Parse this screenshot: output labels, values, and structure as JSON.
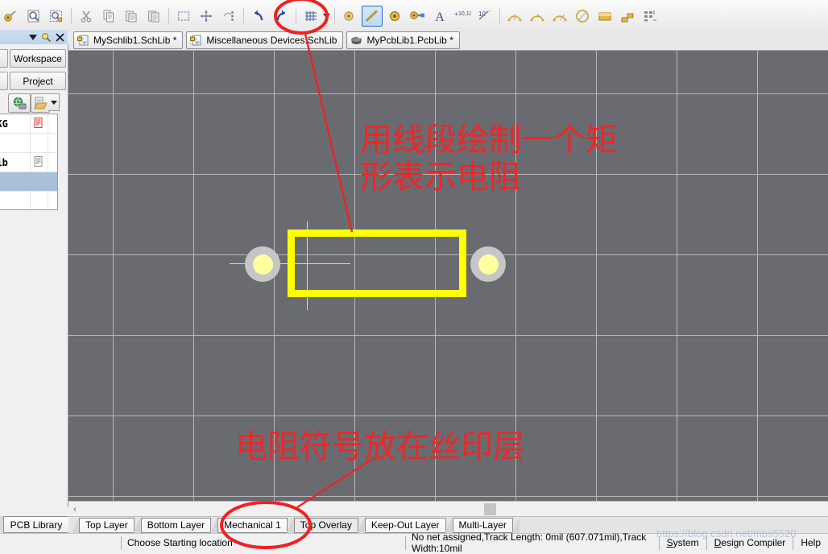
{
  "toolbar": {
    "groups": [
      {
        "name": "file-ops",
        "buttons": [
          {
            "name": "open-icon",
            "glyph": "⚷"
          },
          {
            "name": "zoom-document-icon",
            "glyph": "⌕"
          },
          {
            "name": "zoom-area-icon",
            "glyph": "⌕"
          }
        ]
      },
      {
        "name": "clipboard",
        "buttons": [
          {
            "name": "cut-icon",
            "glyph": "✂"
          },
          {
            "name": "copy-icon",
            "glyph": "⧉"
          },
          {
            "name": "paste-icon",
            "glyph": "⧉"
          },
          {
            "name": "paste-special-icon",
            "glyph": "⧉"
          }
        ]
      },
      {
        "name": "select",
        "buttons": [
          {
            "name": "select-area-icon",
            "glyph": "□"
          },
          {
            "name": "move-icon",
            "glyph": "✛"
          },
          {
            "name": "align-icon",
            "glyph": "⋮"
          }
        ]
      },
      {
        "name": "undo-redo",
        "buttons": [
          {
            "name": "undo-icon",
            "glyph": "↶"
          },
          {
            "name": "redo-icon",
            "glyph": "↷"
          }
        ]
      },
      {
        "name": "grid",
        "buttons": [
          {
            "name": "grid-icon",
            "glyph": "▦"
          },
          {
            "name": "grid-dropdown-arrow-icon",
            "glyph": "▾"
          }
        ]
      },
      {
        "name": "place",
        "buttons": [
          {
            "name": "place-pad-left-icon",
            "glyph": "◎"
          },
          {
            "name": "place-line-icon",
            "glyph": "╱",
            "selected": true
          },
          {
            "name": "place-pad-icon",
            "glyph": "◎"
          },
          {
            "name": "place-via-icon",
            "glyph": "⚷"
          },
          {
            "name": "place-string-icon",
            "glyph": "A"
          },
          {
            "name": "place-coordinate-icon",
            "glyph": "10,10"
          },
          {
            "name": "place-dimension-icon",
            "glyph": "↗"
          }
        ]
      },
      {
        "name": "arcs",
        "buttons": [
          {
            "name": "arc-center-icon",
            "glyph": "◜"
          },
          {
            "name": "arc-edge-icon",
            "glyph": "◜"
          },
          {
            "name": "arc-any-angle-icon",
            "glyph": "◜"
          },
          {
            "name": "full-circle-icon",
            "glyph": "○"
          },
          {
            "name": "place-fill-icon",
            "glyph": "▬"
          },
          {
            "name": "place-polygon-icon",
            "glyph": "▰"
          },
          {
            "name": "place-array-icon",
            "glyph": "∷"
          }
        ]
      }
    ]
  },
  "panel_header": {
    "icons": [
      {
        "name": "panel-dropdown-arrow-icon",
        "glyph": "▼"
      },
      {
        "name": "panel-pin-icon",
        "glyph": "◕"
      },
      {
        "name": "panel-close-icon",
        "glyph": "✕"
      }
    ]
  },
  "sidebar": {
    "buttons": [
      {
        "name": "workspace-button",
        "label": "Workspace"
      },
      {
        "name": "project-button",
        "label": "Project"
      }
    ],
    "tool_icons": [
      {
        "name": "globe-icon",
        "glyph": "◔"
      },
      {
        "name": "open-document-icon",
        "glyph": "⧉"
      },
      {
        "name": "document-dropdown-arrow-icon",
        "glyph": "▾"
      }
    ],
    "list_rows": [
      {
        "name": "row-pkg",
        "label": "BPKG",
        "icon": "document-red-icon",
        "icon_color": "#e33",
        "selected": "none"
      },
      {
        "name": "row-blank1",
        "label": "",
        "icon": "",
        "icon_color": "",
        "selected": "none"
      },
      {
        "name": "row-schlib",
        "label": "hLib",
        "icon": "document-gray-icon",
        "icon_color": "#888",
        "selected": "none"
      },
      {
        "name": "row-hl",
        "label": "",
        "icon": "",
        "icon_color": "",
        "selected": "light"
      },
      {
        "name": "row-blank2",
        "label": "",
        "icon": "",
        "icon_color": "",
        "selected": "none"
      },
      {
        "name": "row-pcblib",
        "label": "",
        "icon": "document-pink-icon",
        "icon_color": "#f08080",
        "selected": "none"
      },
      {
        "name": "row-active",
        "label": "",
        "icon": "document-pink-icon",
        "icon_color": "#ffb0b0",
        "selected": "strong"
      }
    ],
    "bottom_tab": {
      "name": "pcb-library-tab",
      "label": "PCB Library"
    }
  },
  "tabbar": {
    "tabs": [
      {
        "name": "tab-myschlib1",
        "label": "MySchlib1.SchLib *",
        "icon": "schematic-library-icon"
      },
      {
        "name": "tab-misc-devices",
        "label": "Miscellaneous Devices.SchLib",
        "icon": "schematic-library-icon"
      },
      {
        "name": "tab-mypcblib1",
        "label": "MyPcbLib1.PcbLib *",
        "icon": "pcb-library-icon",
        "active": true
      }
    ]
  },
  "canvas": {
    "background_color": "#696b70",
    "grid_color": "#b6b7ba",
    "footprint": {
      "name": "resistor-footprint",
      "silkscreen_color": "#ffff00",
      "pad_ring_color": "#c6c6c6",
      "pad_hole_color": "#ffffa0",
      "pads": [
        {
          "name": "pad-1"
        },
        {
          "name": "pad-2"
        }
      ]
    },
    "annotations": [
      {
        "name": "annotation-draw-rectangle",
        "line1": "用线段绘制一个矩",
        "line2": "形表示电阻",
        "color": "#ef2626"
      },
      {
        "name": "annotation-silkscreen-layer",
        "line1": "电阻符号放在丝印层",
        "line2": "",
        "color": "#ef2626"
      }
    ]
  },
  "scrollbar": {
    "left_arrow": {
      "name": "scroll-left-arrow-icon",
      "glyph": "‹"
    }
  },
  "layers": {
    "tabs": [
      {
        "name": "layer-tab-top-layer",
        "label": "Top Layer",
        "active": false
      },
      {
        "name": "layer-tab-bottom-layer",
        "label": "Bottom Layer",
        "active": false
      },
      {
        "name": "layer-tab-mechanical-1",
        "label": "Mechanical 1",
        "active": false
      },
      {
        "name": "layer-tab-top-overlay",
        "label": "Top Overlay",
        "active": true
      },
      {
        "name": "layer-tab-keepout-layer",
        "label": "Keep-Out Layer",
        "active": false
      },
      {
        "name": "layer-tab-multi-layer",
        "label": "Multi-Layer",
        "active": false
      }
    ]
  },
  "statusbar": {
    "command_hint": "Choose Starting location",
    "track_info": "No net assigned,Track Length: 0mil (607.071mil),Track Width:10mil",
    "watermark": "https://blog.csdn.net/mbs5520",
    "buttons": [
      {
        "name": "system-button",
        "accel": "S",
        "rest": "ystem"
      },
      {
        "name": "design-compiler-button",
        "accel": "D",
        "rest": "esign Compiler"
      },
      {
        "name": "help-button",
        "accel": "",
        "rest": "Help"
      }
    ]
  }
}
